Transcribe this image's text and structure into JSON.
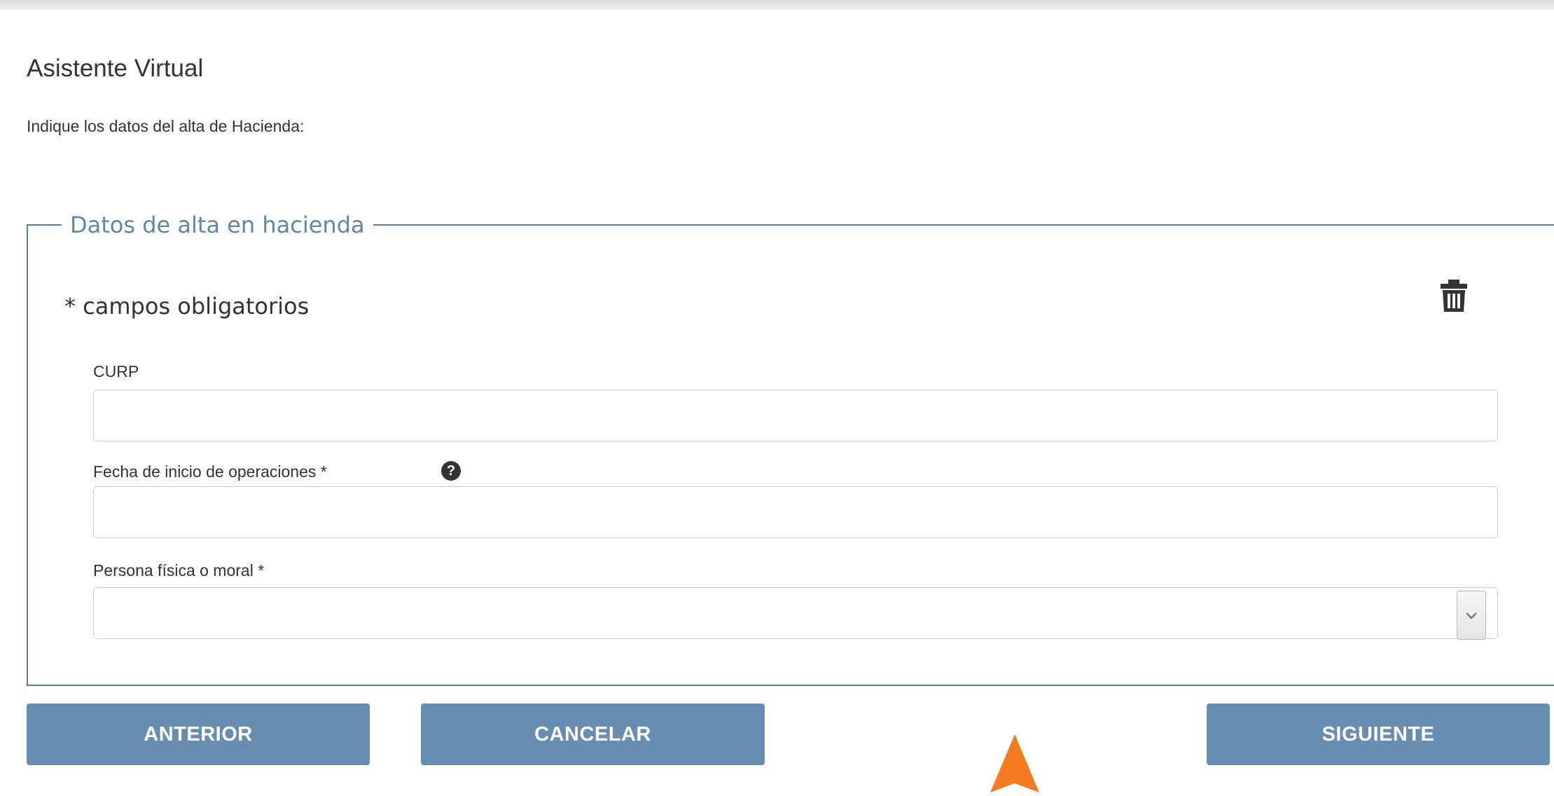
{
  "header": {
    "title": "Asistente Virtual",
    "subtitle": "Indique los datos del alta de Hacienda:"
  },
  "form": {
    "legend": "Datos de alta en hacienda",
    "required_note": "* campos obligatorios",
    "delete_icon": "trash-icon",
    "fields": [
      {
        "label": "CURP",
        "value": "",
        "placeholder": ""
      },
      {
        "label": "Fecha de inicio de operaciones *",
        "value": "",
        "placeholder": "",
        "help_icon": "question-circle-icon"
      },
      {
        "label": "Persona física o moral *",
        "selected": "",
        "control": "select"
      }
    ]
  },
  "buttons": {
    "previous": "ANTERIOR",
    "cancel": "CANCELAR",
    "next": "SIGUIENTE"
  },
  "colors": {
    "button_bg": "#678db0",
    "legend_text": "#5f86a8",
    "fieldset_border": "#5a7b99",
    "cursor": "#f47c20"
  }
}
